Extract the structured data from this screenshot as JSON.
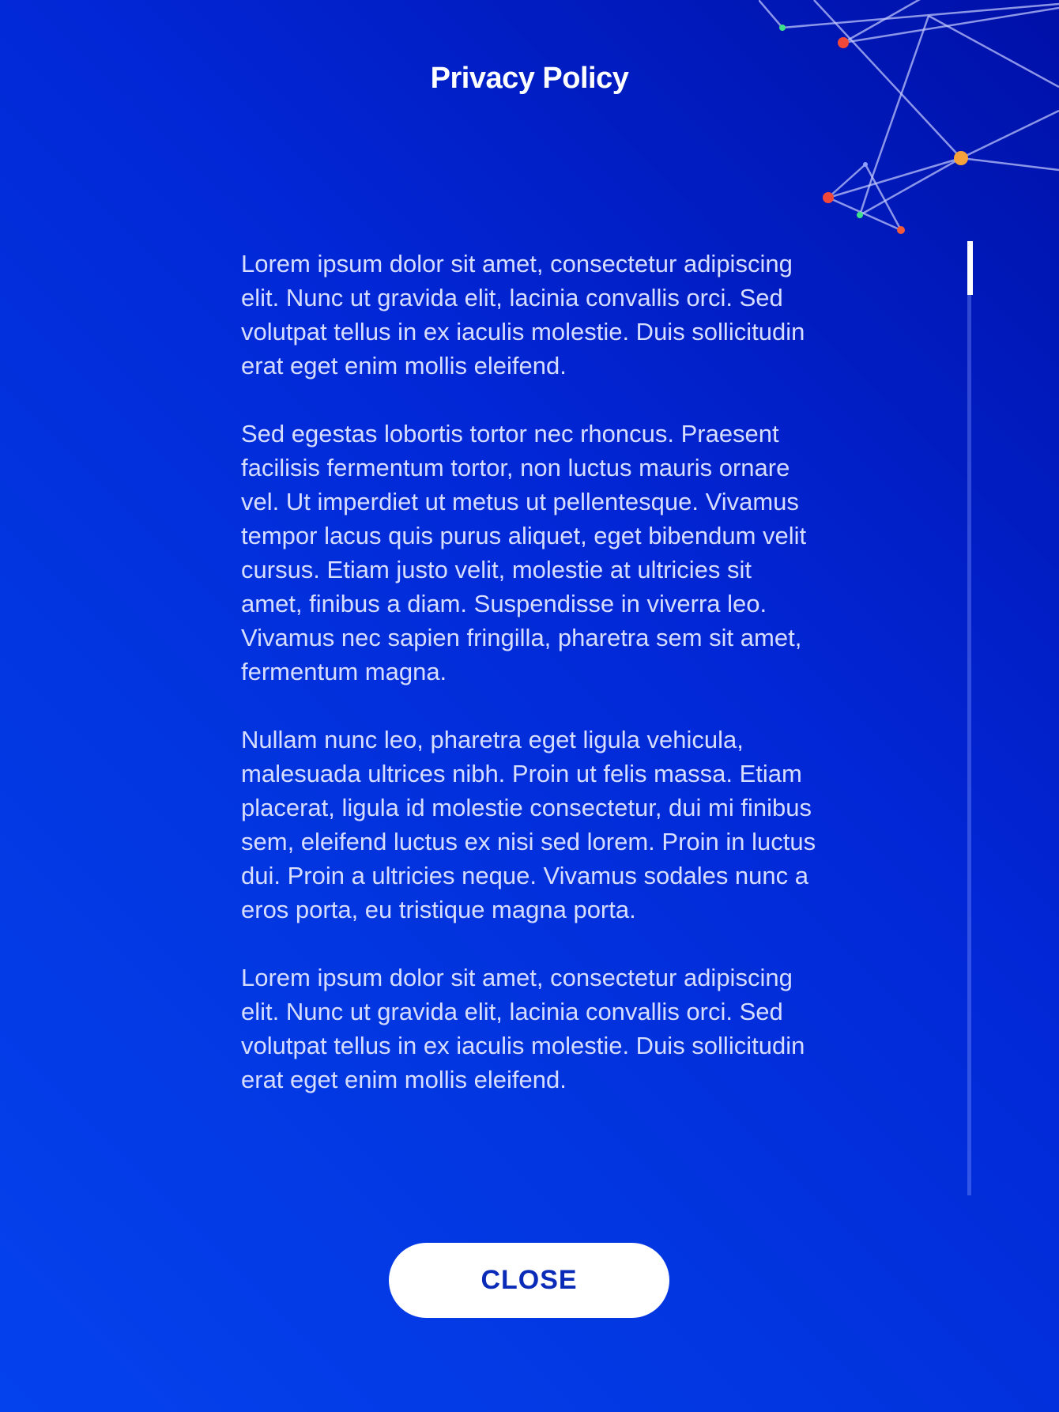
{
  "header": {
    "title": "Privacy Policy"
  },
  "content": {
    "paragraphs": [
      "Lorem ipsum dolor sit amet, consectetur adipiscing elit. Nunc ut gravida elit, lacinia convallis orci. Sed volutpat tellus in ex iaculis molestie. Duis sollicitudin erat eget enim mollis eleifend.",
      "Sed egestas lobortis tortor nec rhoncus. Praesent facilisis fermentum tortor, non luctus mauris ornare vel. Ut imperdiet ut metus ut pellentesque. Vivamus tempor lacus quis purus aliquet, eget bibendum velit cursus. Etiam justo velit, molestie at ultricies sit amet, finibus a diam. Suspendisse in viverra leo. Vivamus nec sapien fringilla, pharetra sem sit amet, fermentum magna.",
      "Nullam nunc leo, pharetra eget ligula vehicula, malesuada ultrices nibh. Proin ut felis massa. Etiam placerat, ligula id molestie consectetur, dui mi finibus sem, eleifend luctus ex nisi sed lorem. Proin in luctus dui. Proin a ultricies neque. Vivamus sodales nunc a eros porta, eu tristique magna porta.",
      "Lorem ipsum dolor sit amet, consectetur adipiscing elit. Nunc ut gravida elit, lacinia convallis orci. Sed volutpat tellus in ex iaculis molestie. Duis sollicitudin erat eget enim mollis eleifend."
    ]
  },
  "scrollbar": {
    "position_fraction": 0.0
  },
  "actions": {
    "close_label": "CLOSE"
  },
  "colors": {
    "background_top": "#0010a8",
    "background_bottom": "#0442ee",
    "text": "#d6ddff",
    "button_bg": "#ffffff",
    "button_text": "#0a2bb8",
    "node_red": "#f2483a",
    "node_orange": "#f5a23c",
    "node_green": "#3fe08a"
  },
  "decoration": {
    "icon": "network-graph-icon"
  }
}
